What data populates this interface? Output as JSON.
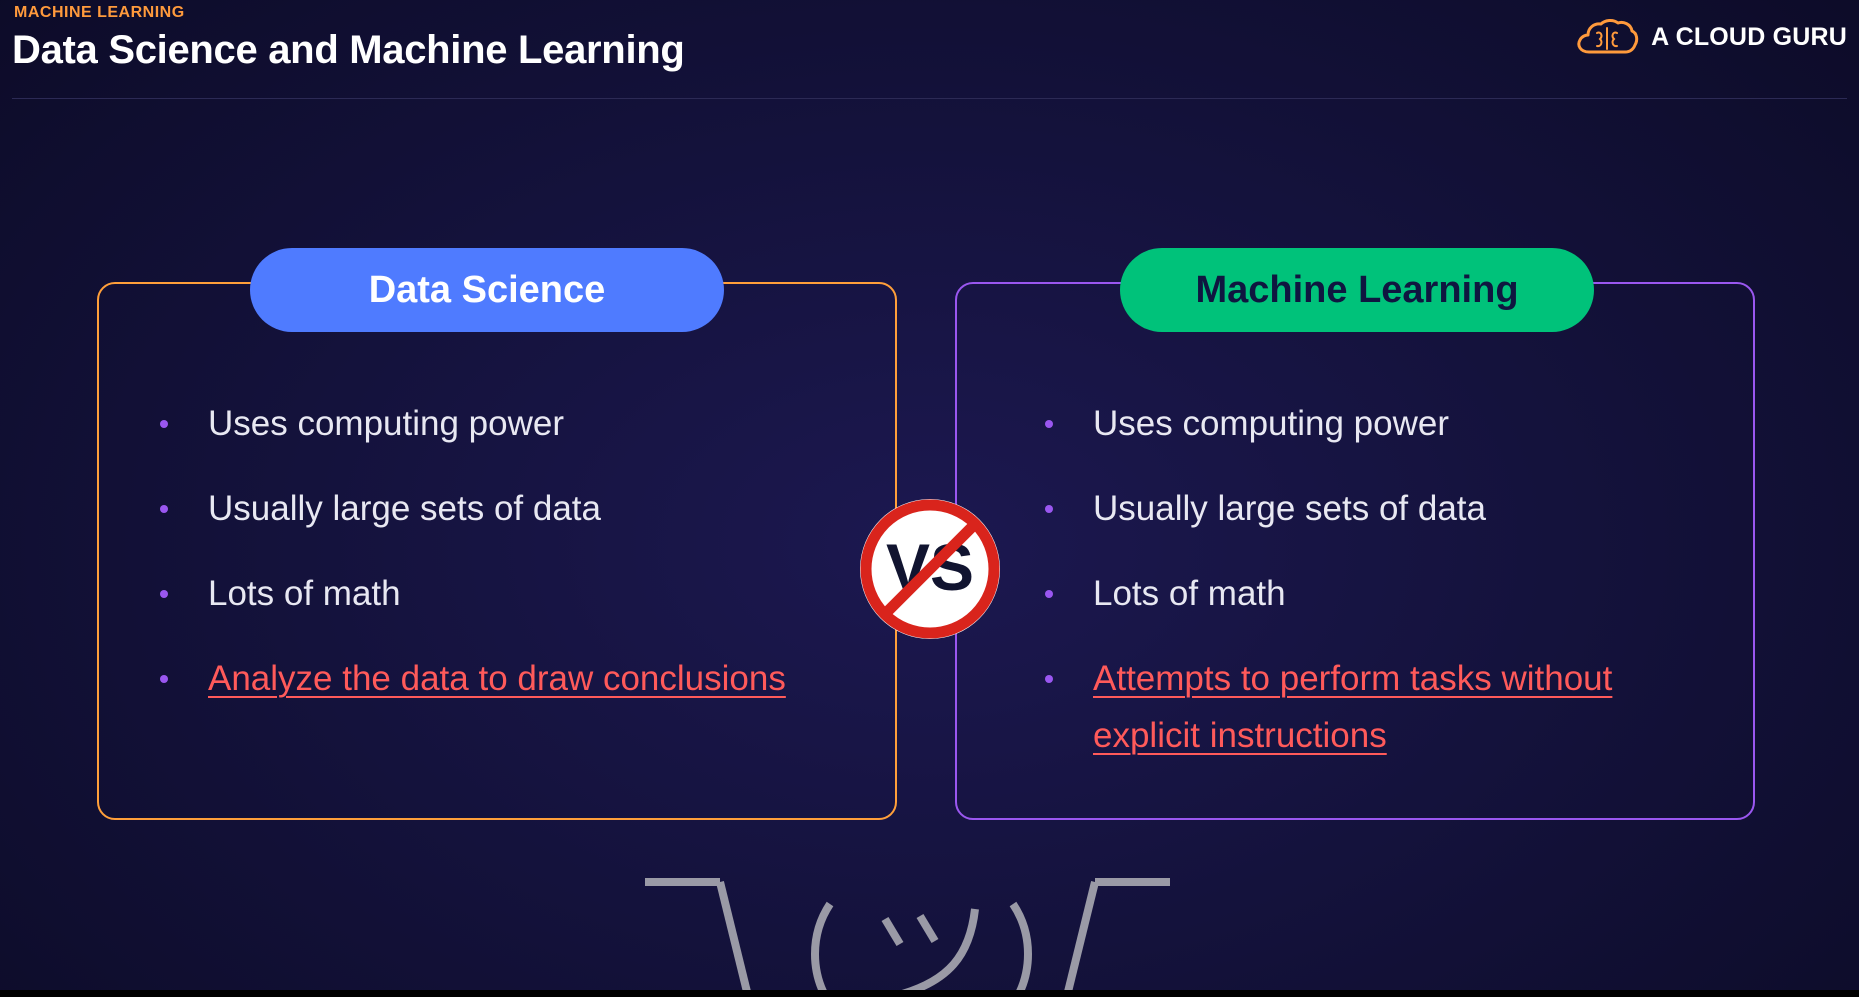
{
  "header": {
    "eyebrow": "MACHINE LEARNING",
    "title": "Data Science and Machine Learning"
  },
  "brand": {
    "name": "A CLOUD GURU",
    "logo_icon": "cloud-brain-icon"
  },
  "left_panel": {
    "heading": "Data Science",
    "bullets": [
      "Uses computing power",
      "Usually large sets of data",
      "Lots of math",
      "Analyze the data to draw conclusions"
    ]
  },
  "right_panel": {
    "heading": "Machine Learning",
    "bullets": [
      "Uses computing power",
      "Usually large sets of data",
      "Lots of math",
      "Attempts to perform tasks without explicit instructions"
    ]
  },
  "vs_badge": {
    "label": "VS"
  },
  "colors": {
    "accent_orange": "#ff9a3c",
    "left_pill": "#4f7bff",
    "right_pill": "#00c27a",
    "left_border": "#ff9f3a",
    "right_border": "#9a57f0",
    "highlight_text": "#ff5a5a",
    "vs_ring": "#d9241c"
  }
}
